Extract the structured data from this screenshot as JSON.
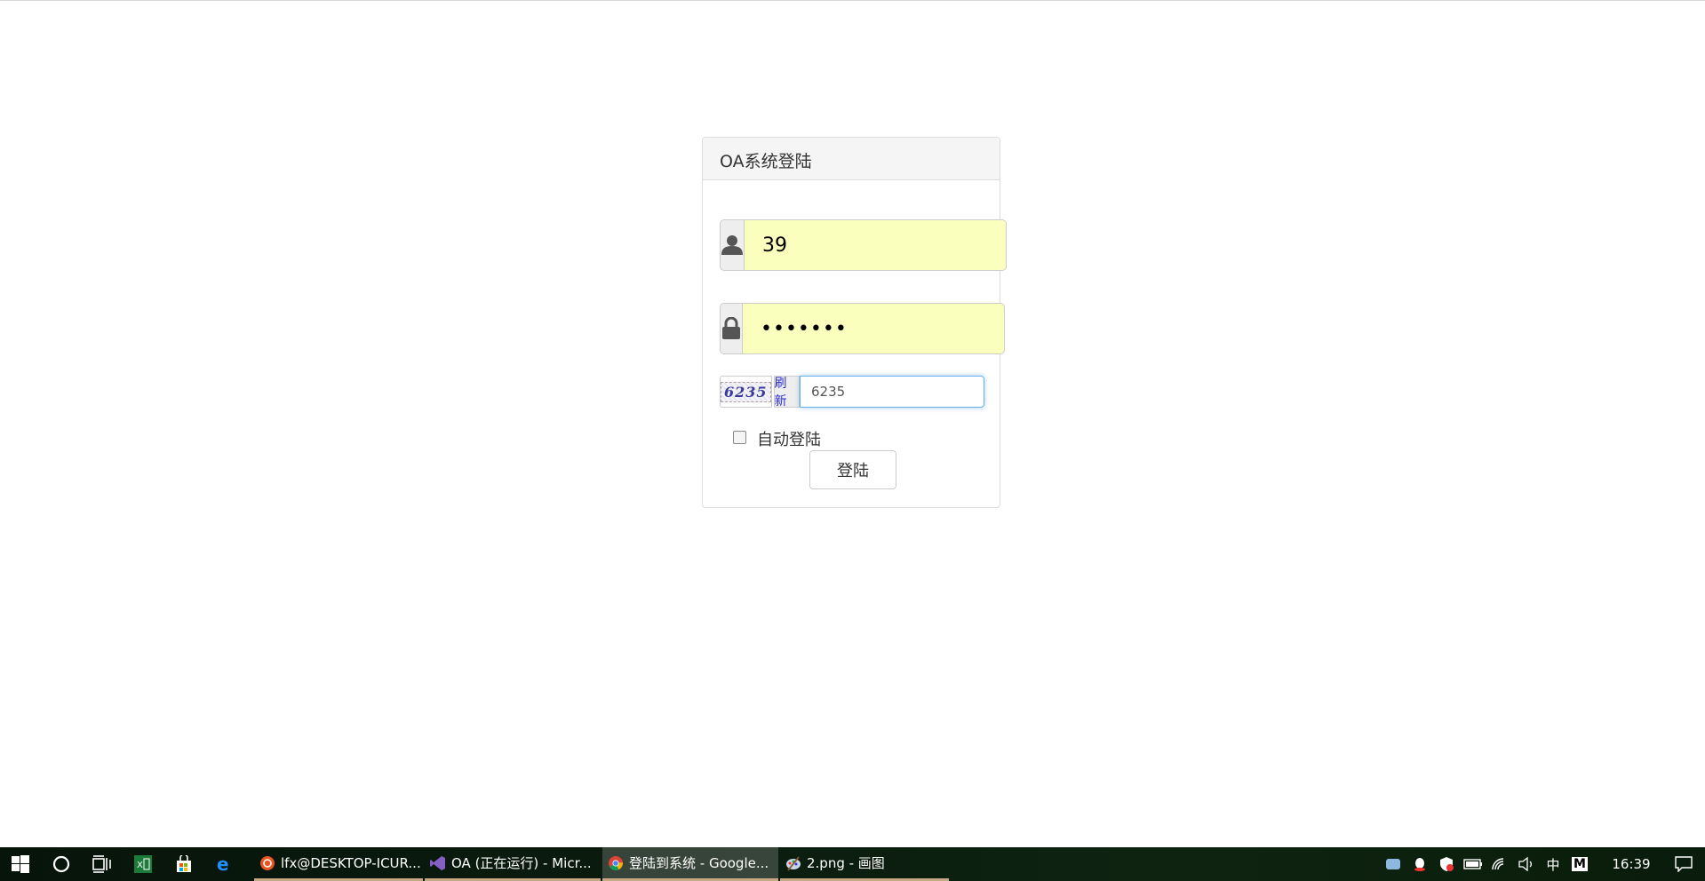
{
  "login": {
    "title": "OA系统登陆",
    "username_value": "39",
    "password_value": "•••••••",
    "captcha_image_text": "6235",
    "refresh_label": "刷新",
    "captcha_value": "6235",
    "remember_label": "自动登陆",
    "remember_checked": false,
    "submit_label": "登陆",
    "autofill_color": "#faffbd",
    "focus_color": "#66afe9"
  },
  "taskbar": {
    "pinned_icons": [
      "windows-start-icon",
      "cortana-icon",
      "task-view-icon",
      "excel-icon",
      "store-icon",
      "edge-icon"
    ],
    "apps": [
      {
        "label": "lfx@DESKTOP-ICUR...",
        "icon": "ubuntu-icon",
        "active": false
      },
      {
        "label": "OA (正在运行) - Micr...",
        "icon": "visual-studio-icon",
        "active": false
      },
      {
        "label": "登陆到系统 - Google...",
        "icon": "chrome-icon",
        "active": true
      },
      {
        "label": "2.png - 画图",
        "icon": "paint-icon",
        "active": false
      }
    ],
    "tray": {
      "ime": "中",
      "ime2": "M",
      "clock": "16:39"
    }
  }
}
